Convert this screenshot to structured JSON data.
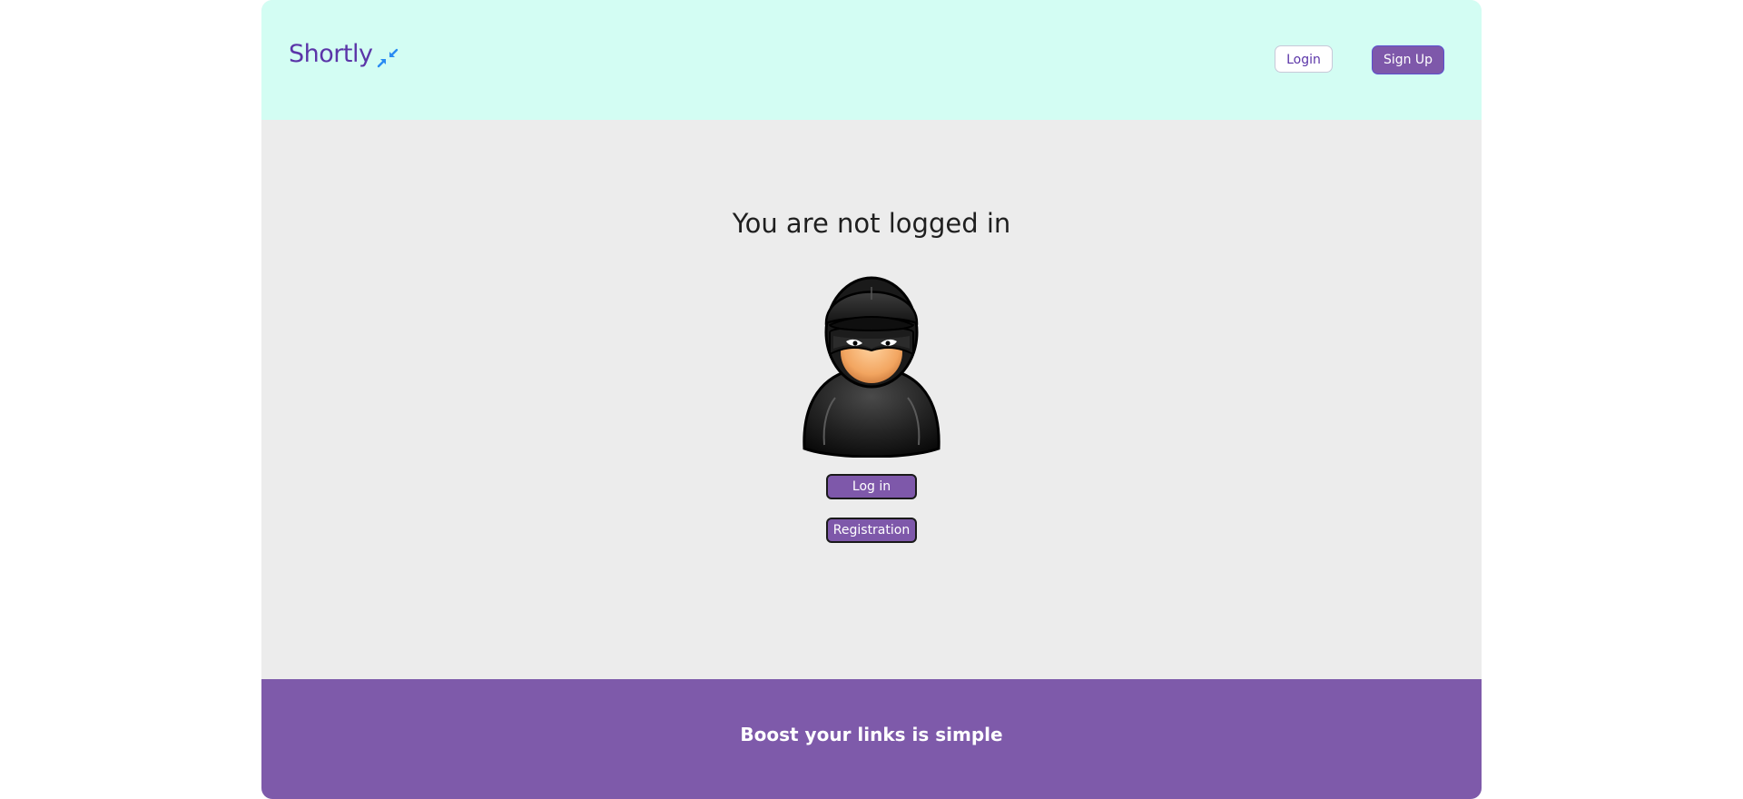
{
  "header": {
    "logo_text": "Shortly",
    "logo_icon": "shrink-arrows-icon",
    "login_label": "Login",
    "signup_label": "Sign Up"
  },
  "main": {
    "title": "You are not logged in",
    "avatar_icon": "anonymous-thief-avatar",
    "log_in_label": "Log in",
    "registration_label": "Registration"
  },
  "footer": {
    "tagline": "Boost your links is simple"
  },
  "colors": {
    "header_bg": "#d3fdf3",
    "main_bg": "#ececec",
    "accent_purple": "#7e58aa",
    "logo_purple": "#5b35a8",
    "logo_icon_blue": "#2a8bf2"
  }
}
